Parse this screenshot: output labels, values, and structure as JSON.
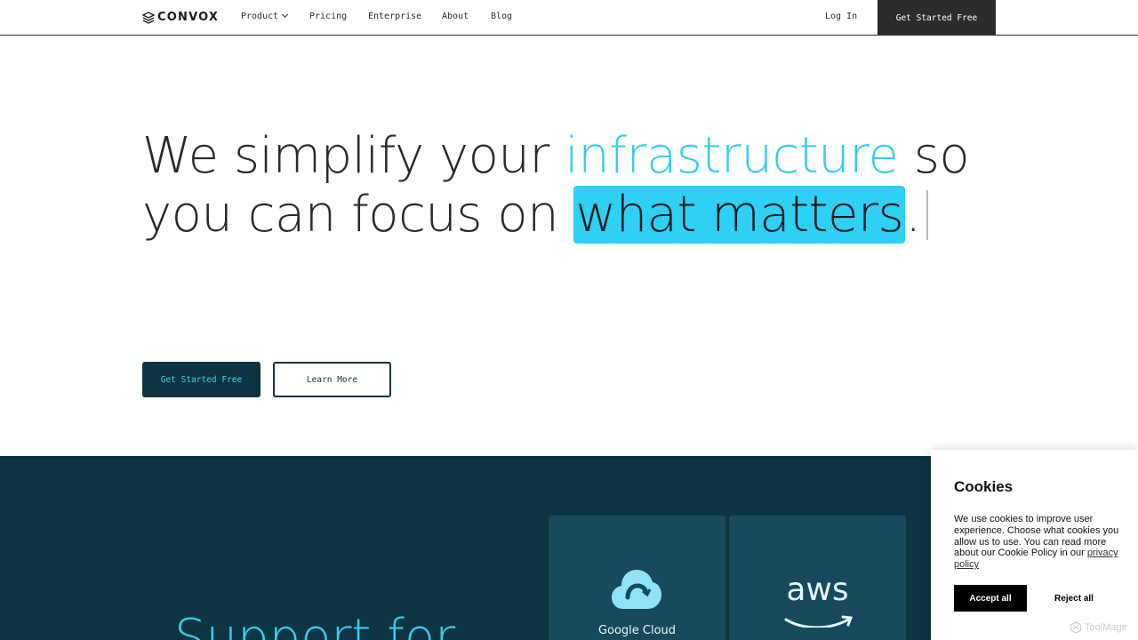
{
  "nav": {
    "brand": "CONVOX",
    "links": [
      {
        "label": "Product"
      },
      {
        "label": "Pricing"
      },
      {
        "label": "Enterprise"
      },
      {
        "label": "About"
      },
      {
        "label": "Blog"
      }
    ],
    "login": "Log In",
    "cta": "Get Started Free"
  },
  "hero": {
    "line1_a": "We simplify your ",
    "line1_highlight": "infrastructure",
    "line1_b": " so",
    "line2_a": "you can focus on ",
    "line2_highlight": "what matters",
    "line2_b": ".",
    "primary_button": "Get Started Free",
    "secondary_button": "Learn More"
  },
  "support": {
    "heading": "Support for",
    "providers": [
      {
        "name": "Google Cloud",
        "icon": "google-cloud-icon"
      },
      {
        "name": "aws",
        "icon": "aws-icon"
      }
    ]
  },
  "cookies": {
    "title": "Cookies",
    "body": "We use cookies to improve user experience. Choose what cookies you allow us to use. You can read more about our Cookie Policy in our ",
    "link": "privacy policy",
    "accept": "Accept all",
    "reject": "Reject all"
  },
  "watermark": "ToolMage",
  "colors": {
    "accent": "#35cdf0",
    "dark": "#0d3442",
    "card": "#174a5c",
    "nav_cta": "#2c2c2c"
  }
}
